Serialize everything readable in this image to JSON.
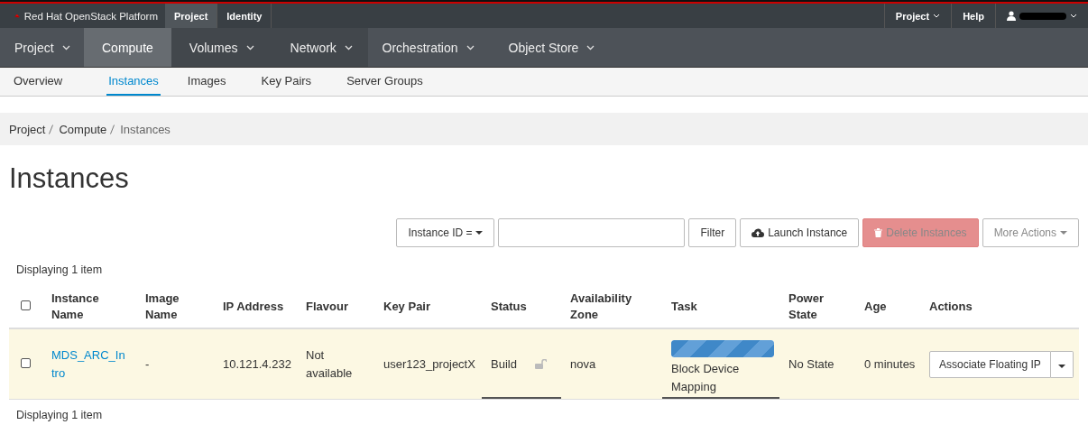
{
  "header": {
    "brand": "Red Hat OpenStack Platform",
    "contexts": [
      {
        "label": "Project",
        "selected": true
      },
      {
        "label": "Identity",
        "selected": false
      }
    ],
    "right_menu": [
      {
        "label": "Project",
        "kind": "dropdown"
      },
      {
        "label": "Help",
        "kind": "link"
      },
      {
        "kind": "user"
      }
    ]
  },
  "nav": [
    {
      "label": "Project",
      "selected": false,
      "dropdown": true
    },
    {
      "label": "Compute",
      "selected": true,
      "dropdown": false
    },
    {
      "label": "Volumes",
      "selected": false,
      "dropdown": true
    },
    {
      "label": "Network",
      "selected": false,
      "dropdown": true
    },
    {
      "label": "Orchestration",
      "selected": false,
      "dropdown": true
    },
    {
      "label": "Object Store",
      "selected": false,
      "dropdown": true
    }
  ],
  "subnav": [
    {
      "label": "Overview",
      "selected": false
    },
    {
      "label": "Instances",
      "selected": true
    },
    {
      "label": "Images",
      "selected": false
    },
    {
      "label": "Key Pairs",
      "selected": false
    },
    {
      "label": "Server Groups",
      "selected": false
    }
  ],
  "breadcrumb": [
    "Project",
    "Compute",
    "Instances"
  ],
  "page_title": "Instances",
  "toolbar": {
    "filter_field": "Instance ID =",
    "filter_button": "Filter",
    "launch": "Launch Instance",
    "delete": {
      "label": "Delete Instances",
      "disabled": true
    },
    "more": {
      "label": "More Actions",
      "disabled": true
    }
  },
  "summary_top": "Displaying 1 item",
  "table": {
    "all_checked": false,
    "columns": [
      "Instance Name",
      "Image Name",
      "IP Address",
      "Flavour",
      "Key Pair",
      "Status",
      "Availability Zone",
      "Task",
      "Power State",
      "Age",
      "Actions"
    ],
    "rows": [
      {
        "checked": false,
        "instance_name": "MDS_ARC_Intro",
        "image_name": "-",
        "ip_address": "10.121.4.232",
        "flavour": "Not available",
        "key_pair": "user123_projectX",
        "status": "Build",
        "locked": false,
        "availability_zone": "nova",
        "task": {
          "level": 1,
          "label": "Block Device Mapping"
        },
        "power_state": "No State",
        "age": "0 minutes",
        "action": "Associate Floating IP"
      }
    ]
  },
  "summary_bottom": "Displaying 1 item"
}
